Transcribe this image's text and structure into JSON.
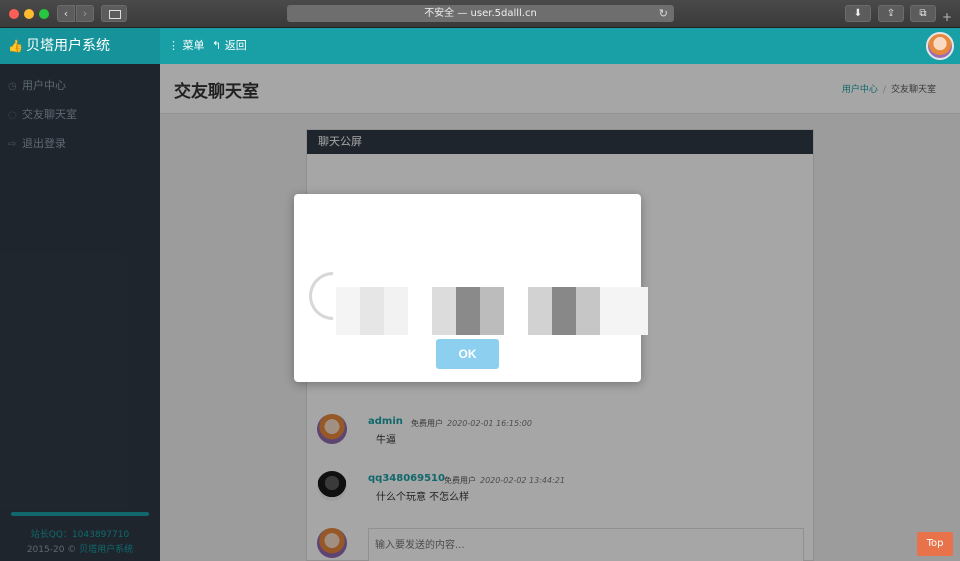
{
  "browser": {
    "address": "不安全 — user.5dalll.cn"
  },
  "header": {
    "brand": "贝塔用户系统",
    "menu_label": "菜单",
    "back_label": "返回"
  },
  "sidebar": {
    "items": [
      {
        "label": "用户中心"
      },
      {
        "label": "交友聊天室"
      },
      {
        "label": "退出登录"
      }
    ],
    "qq_text": "站长QQ：1043897710",
    "copyright_prefix": "2015-20 © ",
    "copyright_link": "贝塔用户系统"
  },
  "page": {
    "title": "交友聊天室",
    "breadcrumb": [
      "用户中心",
      "交友聊天室"
    ]
  },
  "chat": {
    "panel_title": "聊天公屏",
    "messages": [
      {
        "name": "admin",
        "role": "免费用户",
        "time": "2020-02-01 16:15:00",
        "text": "牛逼"
      },
      {
        "name": "qq348069510",
        "role": "免费用户",
        "time": "2020-02-02 13:44:21",
        "text": "什么个玩意 不怎么样"
      }
    ],
    "input_placeholder": "输入要发送的内容..."
  },
  "dialog": {
    "ok_label": "OK"
  },
  "top_button": "Top",
  "colors": {
    "accent": "#19a0a6",
    "sidebar": "#2f3a46",
    "ok_button": "#8ccfef",
    "top_button": "#e8734a"
  }
}
